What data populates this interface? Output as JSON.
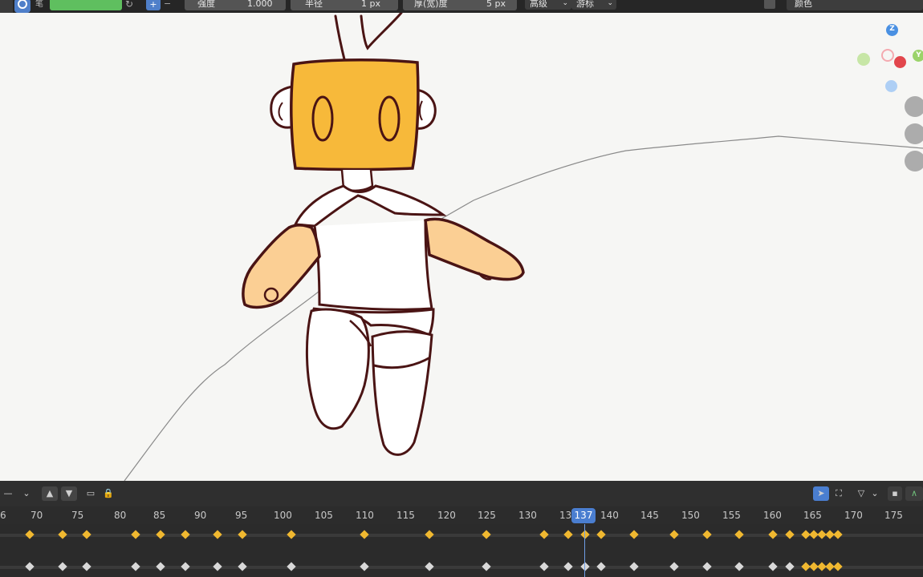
{
  "toolbar": {
    "strength_label": "强度",
    "strength_value": "1.000",
    "radius_label": "半径",
    "radius_value": "1 px",
    "thickness_label": "厚(宽)度",
    "thickness_value": "5 px",
    "advanced_label": "高级",
    "cursor_label": "游标",
    "color_label": "颜色",
    "color_swatch": "#5fbf5f"
  },
  "gizmo": {
    "z_label": "Z",
    "y_label": "Y",
    "colors": {
      "z": "#4a90e2",
      "y": "#9bd36a",
      "x": "#e2464c"
    }
  },
  "character_colors": {
    "head_fill": "#f7b93a",
    "skin_fill": "#fbcf94",
    "outline": "#4a1414",
    "path_line": "#8a8a8a"
  },
  "timeline": {
    "current_frame": "137",
    "ticks": [
      "6",
      "70",
      "75",
      "80",
      "85",
      "90",
      "95",
      "100",
      "105",
      "110",
      "115",
      "120",
      "125",
      "130",
      "13",
      "140",
      "145",
      "150",
      "155",
      "160",
      "165",
      "170",
      "175"
    ],
    "accent": "#4a7ed0",
    "keyframe_color": "#f0b830",
    "keyframe_inactive": "#d8d8d8"
  }
}
